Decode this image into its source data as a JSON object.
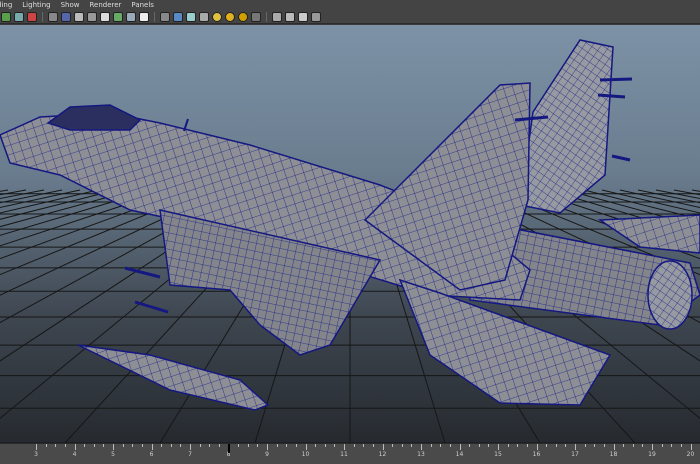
{
  "menu": [
    "ding",
    "Lighting",
    "Show",
    "Renderer",
    "Panels"
  ],
  "toolbar_icons": [
    "select-camera-icon",
    "lock-camera-icon",
    "bookmark-icon",
    "image-plane-icon",
    "grid-icon",
    "film-gate-icon",
    "resolution-gate-icon",
    "gate-mask-icon",
    "field-chart-icon",
    "safe-action-icon",
    "safe-title-icon",
    "wireframe-icon",
    "smooth-shade-icon",
    "smooth-shade-all-icon",
    "default-material-icon",
    "textured-icon",
    "use-all-lights-icon",
    "shadows-icon",
    "ambient-occlusion-icon",
    "isolate-select-icon",
    "xray-icon",
    "xray-joints-icon",
    "highlight-icon"
  ],
  "viewport": {
    "label": "perspective-viewport",
    "model": "fighter-jet-wireframe"
  },
  "timeslider": {
    "frames": [
      "3",
      "4",
      "5",
      "6",
      "7",
      "8",
      "9",
      "10",
      "11",
      "12",
      "13",
      "14",
      "15",
      "16",
      "17",
      "18",
      "19",
      "20"
    ],
    "current_frame": "8"
  },
  "colors": {
    "wire": "#141880",
    "mesh": "#8f8f93",
    "grid": "#1a1a1a",
    "accent": "#2fae4a"
  }
}
